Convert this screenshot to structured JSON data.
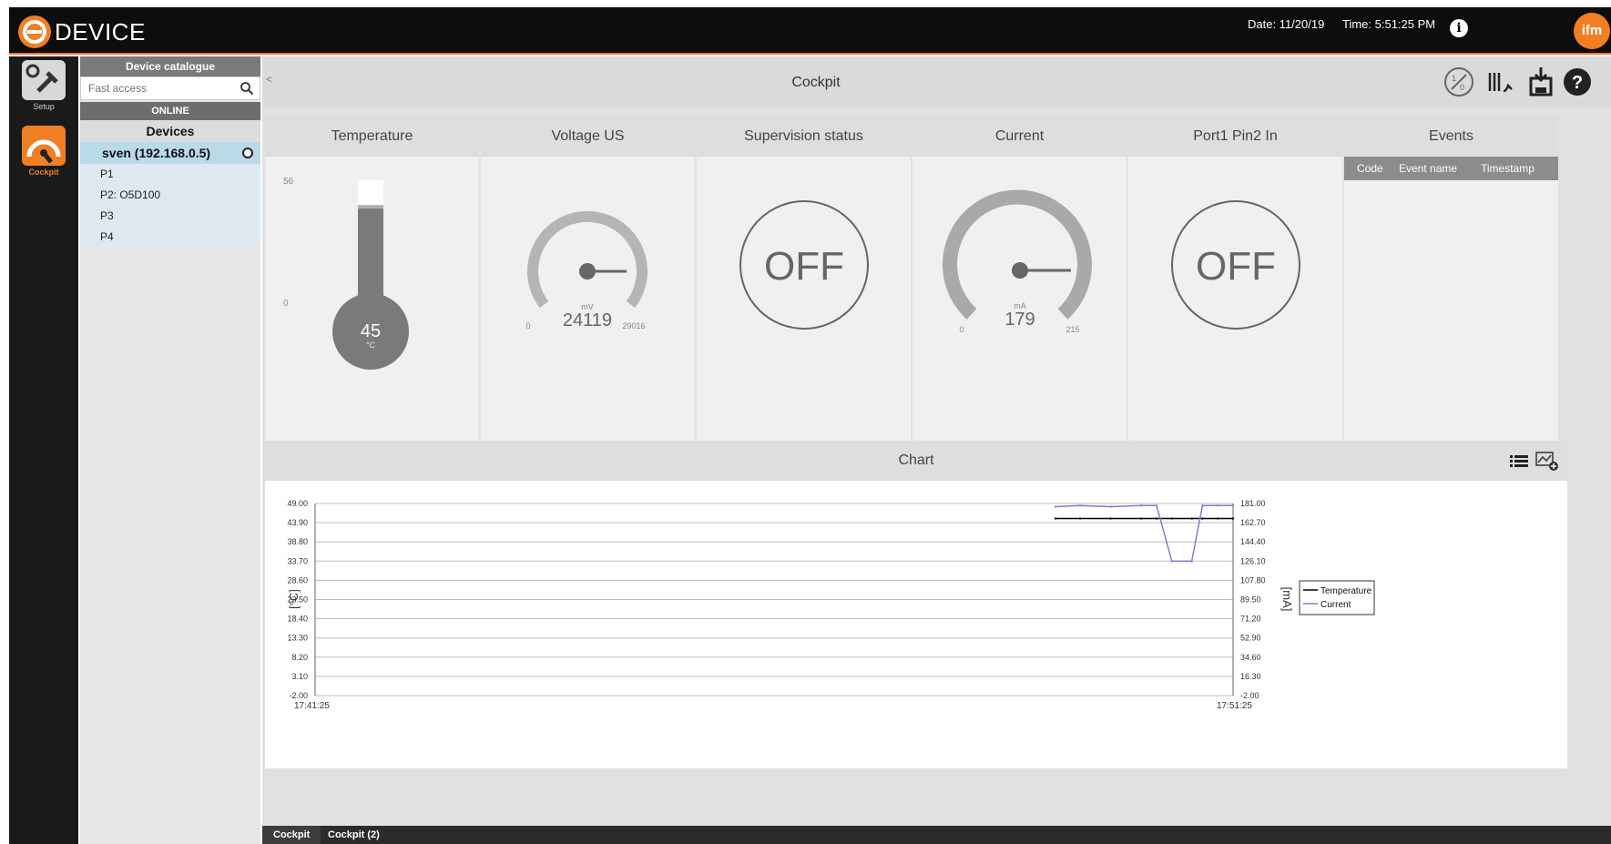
{
  "app": {
    "title": "DEVICE"
  },
  "header": {
    "date": "Date: 11/20/19",
    "time": "Time: 5:51:25 PM",
    "brand_text": "ifm"
  },
  "rail": {
    "items": [
      {
        "label": "Setup"
      },
      {
        "label": "Cockpit"
      }
    ]
  },
  "catalog": {
    "title": "Device catalogue",
    "search_placeholder": "Fast access",
    "online_label": "ONLINE",
    "devices_label": "Devices",
    "device": "sven (192.168.0.5)",
    "ports": [
      "P1",
      "P2: O5D100",
      "P3",
      "P4"
    ]
  },
  "cockpit": {
    "title": "Cockpit",
    "collapse_label": "<"
  },
  "tiles": {
    "temperature": {
      "title": "Temperature",
      "max": "56",
      "min": "0",
      "value": "45",
      "unit": "°C",
      "fill_fraction": 0.8
    },
    "voltage": {
      "title": "Voltage US",
      "min": "0",
      "max": "29016",
      "value": "24119",
      "unit": "mV",
      "fraction": 0.83
    },
    "supervision": {
      "title": "Supervision status",
      "state": "OFF"
    },
    "current": {
      "title": "Current",
      "min": "0",
      "max": "215",
      "value": "179",
      "unit": "mA",
      "fraction": 0.83
    },
    "port1pin2": {
      "title": "Port1 Pin2 In",
      "state": "OFF"
    },
    "events": {
      "title": "Events",
      "columns": [
        "Code",
        "Event name",
        "Timestamp"
      ]
    }
  },
  "chart": {
    "title": "Chart",
    "colors": {
      "temperature": "#000000",
      "current": "#7a7fd1"
    }
  },
  "chart_data": {
    "type": "line",
    "x_ticks": [
      "17:41:25",
      "17:51:25"
    ],
    "y_left": {
      "label": "[°C]",
      "ticks": [
        "49.00",
        "43.90",
        "38.80",
        "33.70",
        "28.60",
        "23.50",
        "18.40",
        "13.30",
        "8.20",
        "3.10",
        "-2.00"
      ],
      "range": [
        -2.0,
        49.0
      ]
    },
    "y_right": {
      "label": "[mA]",
      "ticks": [
        "181.00",
        "162.70",
        "144.40",
        "126.10",
        "107.80",
        "89.50",
        "71.20",
        "52.90",
        "34.60",
        "16.30",
        "-2.00"
      ],
      "range": [
        -2.0,
        181.0
      ]
    },
    "legend": [
      "Temperature",
      "Current"
    ],
    "legend_position": "right",
    "series": [
      {
        "name": "Temperature",
        "axis": "left",
        "x": [
          "17:49:29",
          "17:49:45",
          "17:50:05",
          "17:50:25",
          "17:50:35",
          "17:50:45",
          "17:50:58",
          "17:51:05",
          "17:51:15",
          "17:51:25"
        ],
        "y": [
          45,
          45,
          45,
          45,
          45,
          45,
          45,
          45,
          45,
          45
        ]
      },
      {
        "name": "Current",
        "axis": "right",
        "x": [
          "17:49:29",
          "17:49:45",
          "17:50:05",
          "17:50:25",
          "17:50:35",
          "17:50:45",
          "17:50:58",
          "17:51:05",
          "17:51:15",
          "17:51:25"
        ],
        "y": [
          178,
          179,
          178,
          179,
          179,
          126,
          126,
          179,
          179,
          179
        ]
      }
    ]
  },
  "bottom_tabs": [
    "Cockpit",
    "Cockpit (2)"
  ]
}
